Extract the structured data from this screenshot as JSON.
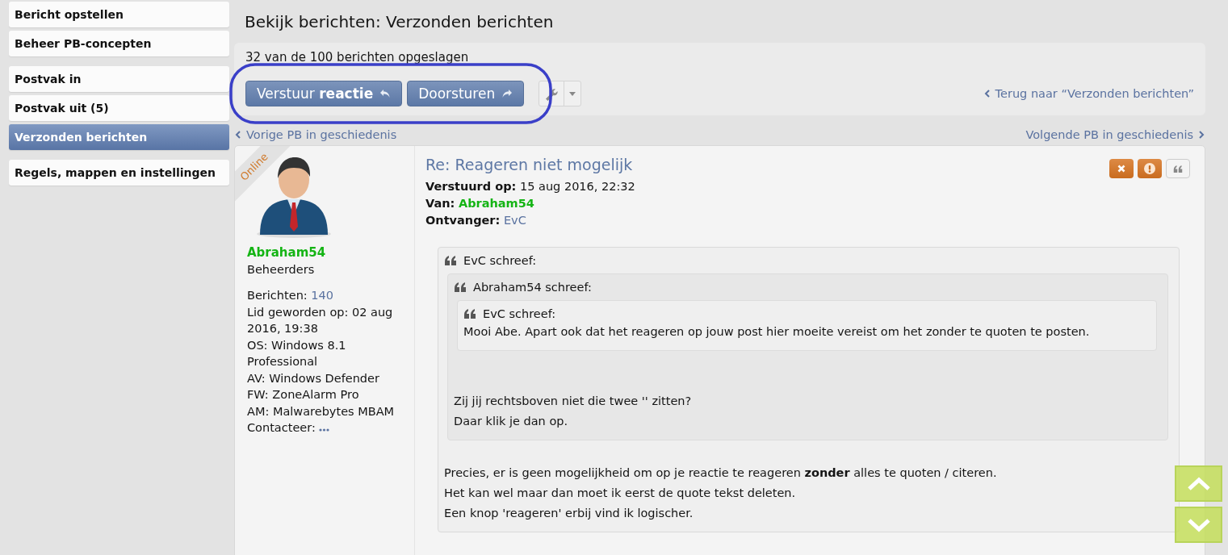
{
  "sidebar": {
    "groups": [
      [
        {
          "label": "Bericht opstellen",
          "selected": false
        },
        {
          "label": "Beheer PB-concepten",
          "selected": false
        }
      ],
      [
        {
          "label": "Postvak in",
          "selected": false
        },
        {
          "label": "Postvak uit (5)",
          "selected": false
        },
        {
          "label": "Verzonden berichten",
          "selected": true
        }
      ],
      [
        {
          "label": "Regels, mappen en instellingen",
          "selected": false
        }
      ]
    ]
  },
  "header": {
    "title": "Bekijk berichten: Verzonden berichten"
  },
  "toolbar": {
    "stats": "32 van de 100 berichten opgeslagen",
    "buttons": [
      {
        "label": "Verstuur **reactie**",
        "kind": "reply"
      },
      {
        "label": "Doorsturen",
        "kind": "forward"
      }
    ],
    "back_link": "Terug naar “Verzonden berichten”"
  },
  "navigation": {
    "previous": "Vorige PB in geschiedenis",
    "next": "Volgende PB in geschiedenis"
  },
  "post": {
    "author": {
      "name": "Abraham54",
      "rank": "Beheerders",
      "status": "Online",
      "profile": [
        {
          "kind": "link",
          "label": "Berichten:",
          "value": "140"
        },
        {
          "kind": "text",
          "text": "Lid geworden op: 02 aug 2016, 19:38"
        },
        {
          "kind": "text",
          "text": "OS: Windows 8.1 Professional"
        },
        {
          "kind": "text",
          "text": "AV: Windows Defender"
        },
        {
          "kind": "text",
          "text": "FW: ZoneAlarm Pro"
        },
        {
          "kind": "text",
          "text": "AM: Malwarebytes MBAM"
        },
        {
          "kind": "more",
          "label": "Contacteer:"
        }
      ]
    },
    "title": "Re: Reageren niet mogelijk",
    "meta": [
      {
        "kind": "text",
        "label": "Verstuurd op:",
        "value": "15 aug 2016, 22:32"
      },
      {
        "kind": "user",
        "label": "Van:",
        "value": "Abraham54"
      },
      {
        "kind": "link",
        "label": "Ontvanger:",
        "value": "EvC"
      }
    ],
    "actions": [
      {
        "kind": "delete"
      },
      {
        "kind": "report"
      },
      {
        "kind": "quote"
      }
    ],
    "body": [
      {
        "kind": "quote",
        "cite": "EvC schreef:",
        "blocks": [
          {
            "kind": "quote",
            "cite": "Abraham54 schreef:",
            "blocks": [
              {
                "kind": "quote",
                "cite": "EvC schreef:",
                "blocks": [
                  {
                    "kind": "text",
                    "text": "Mooi Abe. Apart ook dat het reageren op jouw post hier moeite vereist om het zonder te quoten te posten."
                  }
                ]
              },
              {
                "kind": "text",
                "text": "Zij jij rechtsboven niet die twee '' zitten?"
              },
              {
                "kind": "text",
                "text": "Daar klik je dan op."
              }
            ]
          },
          {
            "kind": "text",
            "text": "Precies, er is geen mogelijkheid om op je reactie te reageren **zonder** alles te quoten / citeren."
          },
          {
            "kind": "text",
            "text": "Het kan wel maar dan moet ik eerst de quote tekst deleten."
          },
          {
            "kind": "text",
            "text": "Een knop 'reageren' erbij vind ik logischer."
          }
        ]
      }
    ]
  }
}
